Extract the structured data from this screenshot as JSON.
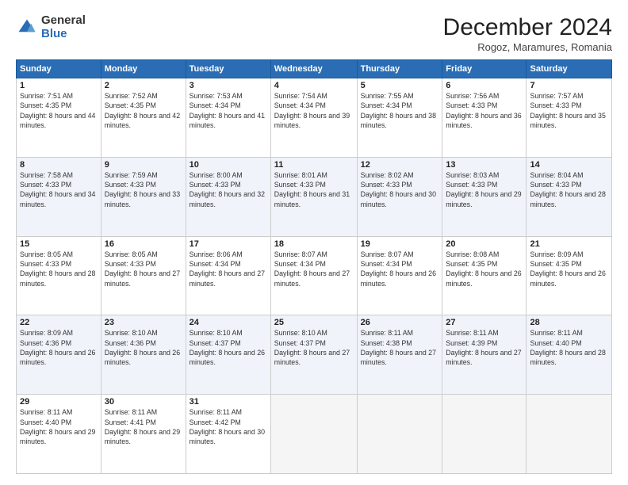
{
  "logo": {
    "general": "General",
    "blue": "Blue"
  },
  "header": {
    "month": "December 2024",
    "location": "Rogoz, Maramures, Romania"
  },
  "weekdays": [
    "Sunday",
    "Monday",
    "Tuesday",
    "Wednesday",
    "Thursday",
    "Friday",
    "Saturday"
  ],
  "weeks": [
    [
      {
        "day": "1",
        "sunrise": "7:51 AM",
        "sunset": "4:35 PM",
        "daylight": "8 hours and 44 minutes."
      },
      {
        "day": "2",
        "sunrise": "7:52 AM",
        "sunset": "4:35 PM",
        "daylight": "8 hours and 42 minutes."
      },
      {
        "day": "3",
        "sunrise": "7:53 AM",
        "sunset": "4:34 PM",
        "daylight": "8 hours and 41 minutes."
      },
      {
        "day": "4",
        "sunrise": "7:54 AM",
        "sunset": "4:34 PM",
        "daylight": "8 hours and 39 minutes."
      },
      {
        "day": "5",
        "sunrise": "7:55 AM",
        "sunset": "4:34 PM",
        "daylight": "8 hours and 38 minutes."
      },
      {
        "day": "6",
        "sunrise": "7:56 AM",
        "sunset": "4:33 PM",
        "daylight": "8 hours and 36 minutes."
      },
      {
        "day": "7",
        "sunrise": "7:57 AM",
        "sunset": "4:33 PM",
        "daylight": "8 hours and 35 minutes."
      }
    ],
    [
      {
        "day": "8",
        "sunrise": "7:58 AM",
        "sunset": "4:33 PM",
        "daylight": "8 hours and 34 minutes."
      },
      {
        "day": "9",
        "sunrise": "7:59 AM",
        "sunset": "4:33 PM",
        "daylight": "8 hours and 33 minutes."
      },
      {
        "day": "10",
        "sunrise": "8:00 AM",
        "sunset": "4:33 PM",
        "daylight": "8 hours and 32 minutes."
      },
      {
        "day": "11",
        "sunrise": "8:01 AM",
        "sunset": "4:33 PM",
        "daylight": "8 hours and 31 minutes."
      },
      {
        "day": "12",
        "sunrise": "8:02 AM",
        "sunset": "4:33 PM",
        "daylight": "8 hours and 30 minutes."
      },
      {
        "day": "13",
        "sunrise": "8:03 AM",
        "sunset": "4:33 PM",
        "daylight": "8 hours and 29 minutes."
      },
      {
        "day": "14",
        "sunrise": "8:04 AM",
        "sunset": "4:33 PM",
        "daylight": "8 hours and 28 minutes."
      }
    ],
    [
      {
        "day": "15",
        "sunrise": "8:05 AM",
        "sunset": "4:33 PM",
        "daylight": "8 hours and 28 minutes."
      },
      {
        "day": "16",
        "sunrise": "8:05 AM",
        "sunset": "4:33 PM",
        "daylight": "8 hours and 27 minutes."
      },
      {
        "day": "17",
        "sunrise": "8:06 AM",
        "sunset": "4:34 PM",
        "daylight": "8 hours and 27 minutes."
      },
      {
        "day": "18",
        "sunrise": "8:07 AM",
        "sunset": "4:34 PM",
        "daylight": "8 hours and 27 minutes."
      },
      {
        "day": "19",
        "sunrise": "8:07 AM",
        "sunset": "4:34 PM",
        "daylight": "8 hours and 26 minutes."
      },
      {
        "day": "20",
        "sunrise": "8:08 AM",
        "sunset": "4:35 PM",
        "daylight": "8 hours and 26 minutes."
      },
      {
        "day": "21",
        "sunrise": "8:09 AM",
        "sunset": "4:35 PM",
        "daylight": "8 hours and 26 minutes."
      }
    ],
    [
      {
        "day": "22",
        "sunrise": "8:09 AM",
        "sunset": "4:36 PM",
        "daylight": "8 hours and 26 minutes."
      },
      {
        "day": "23",
        "sunrise": "8:10 AM",
        "sunset": "4:36 PM",
        "daylight": "8 hours and 26 minutes."
      },
      {
        "day": "24",
        "sunrise": "8:10 AM",
        "sunset": "4:37 PM",
        "daylight": "8 hours and 26 minutes."
      },
      {
        "day": "25",
        "sunrise": "8:10 AM",
        "sunset": "4:37 PM",
        "daylight": "8 hours and 27 minutes."
      },
      {
        "day": "26",
        "sunrise": "8:11 AM",
        "sunset": "4:38 PM",
        "daylight": "8 hours and 27 minutes."
      },
      {
        "day": "27",
        "sunrise": "8:11 AM",
        "sunset": "4:39 PM",
        "daylight": "8 hours and 27 minutes."
      },
      {
        "day": "28",
        "sunrise": "8:11 AM",
        "sunset": "4:40 PM",
        "daylight": "8 hours and 28 minutes."
      }
    ],
    [
      {
        "day": "29",
        "sunrise": "8:11 AM",
        "sunset": "4:40 PM",
        "daylight": "8 hours and 29 minutes."
      },
      {
        "day": "30",
        "sunrise": "8:11 AM",
        "sunset": "4:41 PM",
        "daylight": "8 hours and 29 minutes."
      },
      {
        "day": "31",
        "sunrise": "8:11 AM",
        "sunset": "4:42 PM",
        "daylight": "8 hours and 30 minutes."
      },
      null,
      null,
      null,
      null
    ]
  ]
}
